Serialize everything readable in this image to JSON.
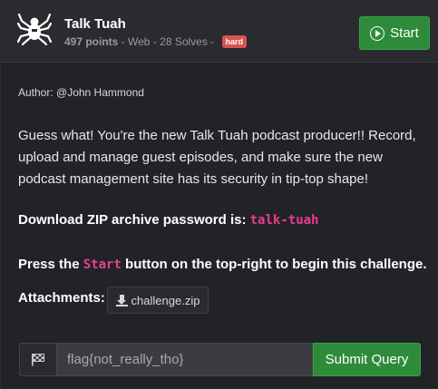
{
  "challenge": {
    "title": "Talk Tuah",
    "points": "497 points",
    "meta_rest": " - Web - 28 Solves - ",
    "difficulty": "hard",
    "start_label": "Start",
    "author": "Author: @John Hammond",
    "description": "Guess what! You're the new Talk Tuah podcast producer!! Record, upload and manage guest episodes, and make sure the new podcast management site has its security in tip-top shape!",
    "download_text": "Download ZIP archive password is: ",
    "zip_password": "talk-tuah",
    "press_prefix": "Press the ",
    "press_code": "Start",
    "press_suffix": " button on the top-right to begin this challenge.",
    "attachments_label": "Attachments:",
    "attachment_file": "challenge.zip"
  },
  "flag_form": {
    "placeholder": "flag{not_really_tho}",
    "submit_label": "Submit Query"
  },
  "icons": {
    "category": "spider-icon",
    "start": "play-circle-icon",
    "attachment": "download-icon",
    "flag": "checkered-flag-icon"
  },
  "colors": {
    "accent_green": "#2e8b3a",
    "badge_red": "#d9534f",
    "code_pink": "#e83e8c"
  }
}
